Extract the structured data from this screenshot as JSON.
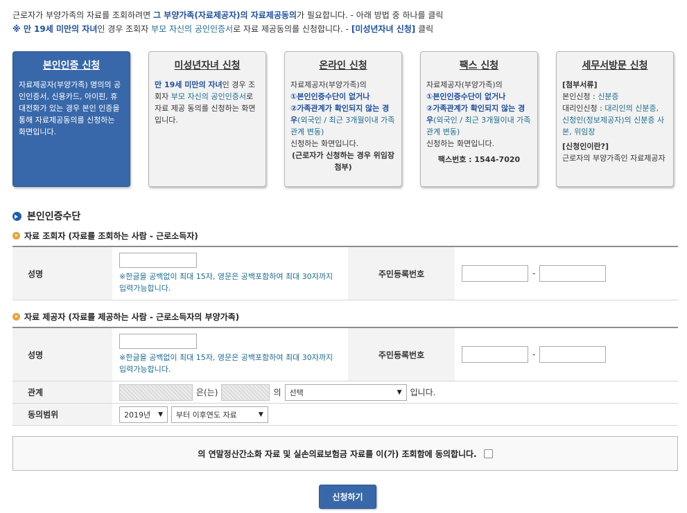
{
  "intro": {
    "line1_a": "근로자가 부양가족의 자료를 조회하려면 ",
    "line1_b": "그 부양가족(자료제공자)의 자료제공동의",
    "line1_c": "가 필요합니다. - 아래 방법 중 하나를 클릭",
    "line2_a": "※ 만 19세 미만의 자녀",
    "line2_b": "인 경우 조회자 ",
    "line2_c": "부모 자신의 공인인증서",
    "line2_d": "로 자료 제공동의를 신청합니다. - ",
    "line2_e": "[미성년자녀 신청]",
    "line2_f": " 클릭"
  },
  "cards": {
    "self": {
      "title": "본인인증 신청",
      "body": "자료제공자(부양가족) 명의의 공인인증서, 신용카드, 아이핀, 휴대전화가 있는 경우 본인 인증을 통해 자료제공동의를 신청하는 화면입니다."
    },
    "minor": {
      "title": "미성년자녀 신청",
      "b1": "만 19세 미만의 자녀",
      "b2": "인 경우 조회자 ",
      "b3": "부모 자신의 공인인증서",
      "b4": "로 자료 제공 동의를 신청하는 화면입니다."
    },
    "online": {
      "title": "온라인 신청",
      "b1": "자료제공자(부양가족)의",
      "b2": "①본인인증수단이 없거나",
      "b3": "②가족관계가 확인되지 않는 경우",
      "b4": "(외국인 / 최근 3개월이내 가족관계 변동)",
      "b5": "신청하는 화면입니다.",
      "b6": "(근로자가 신청하는 경우 위임장 첨부)"
    },
    "fax": {
      "title": "팩스 신청",
      "b1": "자료제공자(부양가족)의",
      "b2": "①본인인증수단이 없거나",
      "b3": "②가족관계가 확인되지 않는 경우",
      "b4": "(외국인 / 최근 3개월이내 가족관계 변동)",
      "b5": "신청하는 화면입니다.",
      "b6": "팩스번호 : 1544-7020"
    },
    "visit": {
      "title": "세무서방문 신청",
      "b1": "[첨부서류]",
      "b2": "본인신청 : ",
      "b3": "신분증",
      "b4": "대리인신청 : ",
      "b5": "대리인의 신분증, 신청인(정보제공자)의 신분증 사본, 위임장",
      "b6": "[신청인이란?]",
      "b7": "근로자의 부양가족인 자료제공자"
    }
  },
  "section": {
    "title": "본인인증수단"
  },
  "viewer": {
    "subtitle": "자료 조회자 (자료를 조회하는 사람 - 근로소득자)",
    "name_label": "성명",
    "name_note": "※한글을 공백없이 최대 15자, 영문은 공백포함하여 최대 30자까지 입력가능합니다.",
    "ssn_label": "주민등록번호",
    "dash": "-"
  },
  "provider": {
    "subtitle": "자료 제공자 (자료를 제공하는 사람 - 근로소득자의 부양가족)",
    "name_label": "성명",
    "name_note": "※한글을 공백없이 최대 15자, 영문은 공백포함하여 최대 30자까지 입력가능합니다.",
    "ssn_label": "주민등록번호",
    "dash": "-",
    "relation_label": "관계",
    "relation_mid": "은(는)",
    "relation_of": "의",
    "relation_select": "선택",
    "relation_end": "입니다.",
    "scope_label": "동의범위",
    "scope_year": "2019년",
    "scope_range": "부터 이후연도 자료"
  },
  "agree": {
    "text": "의 연말정산간소화 자료 및 실손의료보험금 자료를 이(가) 조회함에 동의합니다."
  },
  "submit": {
    "label": "신청하기"
  }
}
